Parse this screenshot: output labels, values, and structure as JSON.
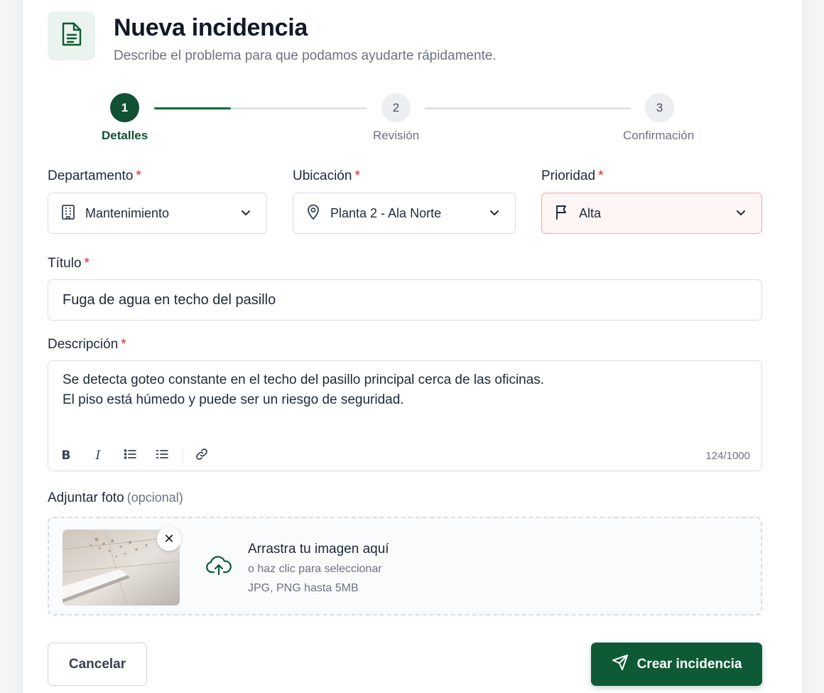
{
  "header": {
    "title": "Nueva incidencia",
    "subtitle": "Describe el problema para que podamos ayudarte rápidamente.",
    "icon": "document-icon"
  },
  "stepper": {
    "progress_first_segment": 0.36,
    "steps": [
      {
        "number": "1",
        "label": "Detalles",
        "state": "active"
      },
      {
        "number": "2",
        "label": "Revisión",
        "state": "pending"
      },
      {
        "number": "3",
        "label": "Confirmación",
        "state": "pending"
      }
    ]
  },
  "fields": {
    "department": {
      "label": "Departamento",
      "required_mark": "*",
      "value": "Mantenimiento",
      "icon": "building-icon"
    },
    "location": {
      "label": "Ubicación",
      "required_mark": "*",
      "value": "Planta 2 - Ala Norte",
      "icon": "map-pin-icon"
    },
    "priority": {
      "label": "Prioridad",
      "required_mark": "*",
      "value": "Alta",
      "icon": "flag-icon"
    },
    "title": {
      "label": "Título",
      "required_mark": "*",
      "value": "Fuga de agua en techo del pasillo"
    },
    "description": {
      "label": "Descripción",
      "required_mark": "*",
      "lines": [
        "Se detecta goteo constante en el techo del pasillo principal cerca de las oficinas.",
        "El piso está húmedo y puede ser un riesgo de seguridad."
      ],
      "char_count": "124/1000",
      "toolbar": {
        "bold": "B",
        "italic": "I"
      }
    }
  },
  "attachment": {
    "label": "Adjuntar foto",
    "optional_text": "(opcional)",
    "remove_glyph": "✕",
    "drop_main": "Arrastra tu imagen aquí",
    "drop_sub": "o haz clic para seleccionar",
    "drop_hint": "JPG, PNG hasta 5MB"
  },
  "actions": {
    "cancel_label": "Cancelar",
    "create_label": "Crear incidencia"
  },
  "colors": {
    "accent": "#0f5a36",
    "required": "#dc2626",
    "priority_border": "#f4a6a6"
  }
}
